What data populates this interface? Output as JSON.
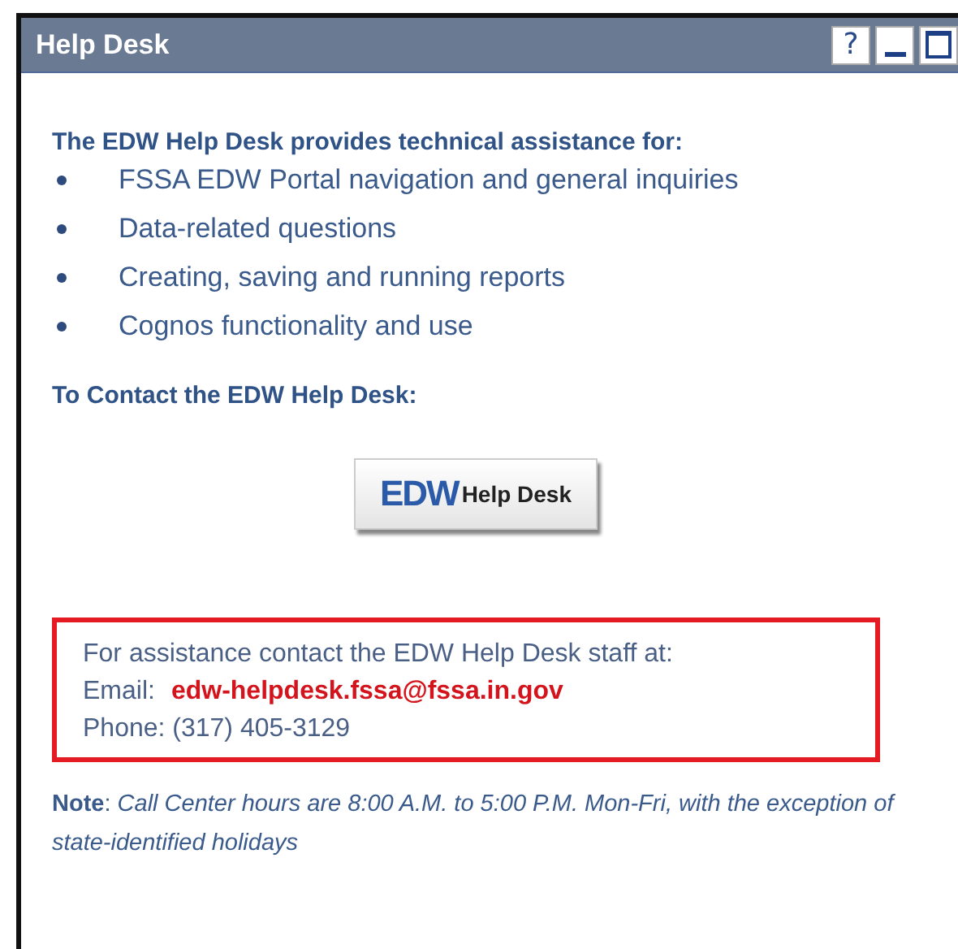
{
  "window": {
    "title": "Help Desk",
    "controls": [
      {
        "kind": "help",
        "label": "?"
      },
      {
        "kind": "minimize"
      },
      {
        "kind": "maximize"
      }
    ]
  },
  "intro": "The EDW Help Desk provides technical assistance for:",
  "services": [
    "FSSA EDW Portal navigation and general inquiries",
    "Data-related questions",
    "Creating, saving and running reports",
    "Cognos functionality and use"
  ],
  "contact_heading": "To Contact the EDW Help Desk:",
  "help_desk_button": {
    "logo": "EDW",
    "label": "Help Desk"
  },
  "contact_box": {
    "intro": "For assistance contact the EDW Help Desk staff at:",
    "email_label": "Email:",
    "email": "edw-helpdesk.fssa@fssa.in.gov",
    "phone": "Phone: (317) 405-3129"
  },
  "note": "**Note**: *Call Center hours are 8:00 A.M. to 5:00 P.M. Mon-Fri, with the exception of state-identified holidays*"
}
